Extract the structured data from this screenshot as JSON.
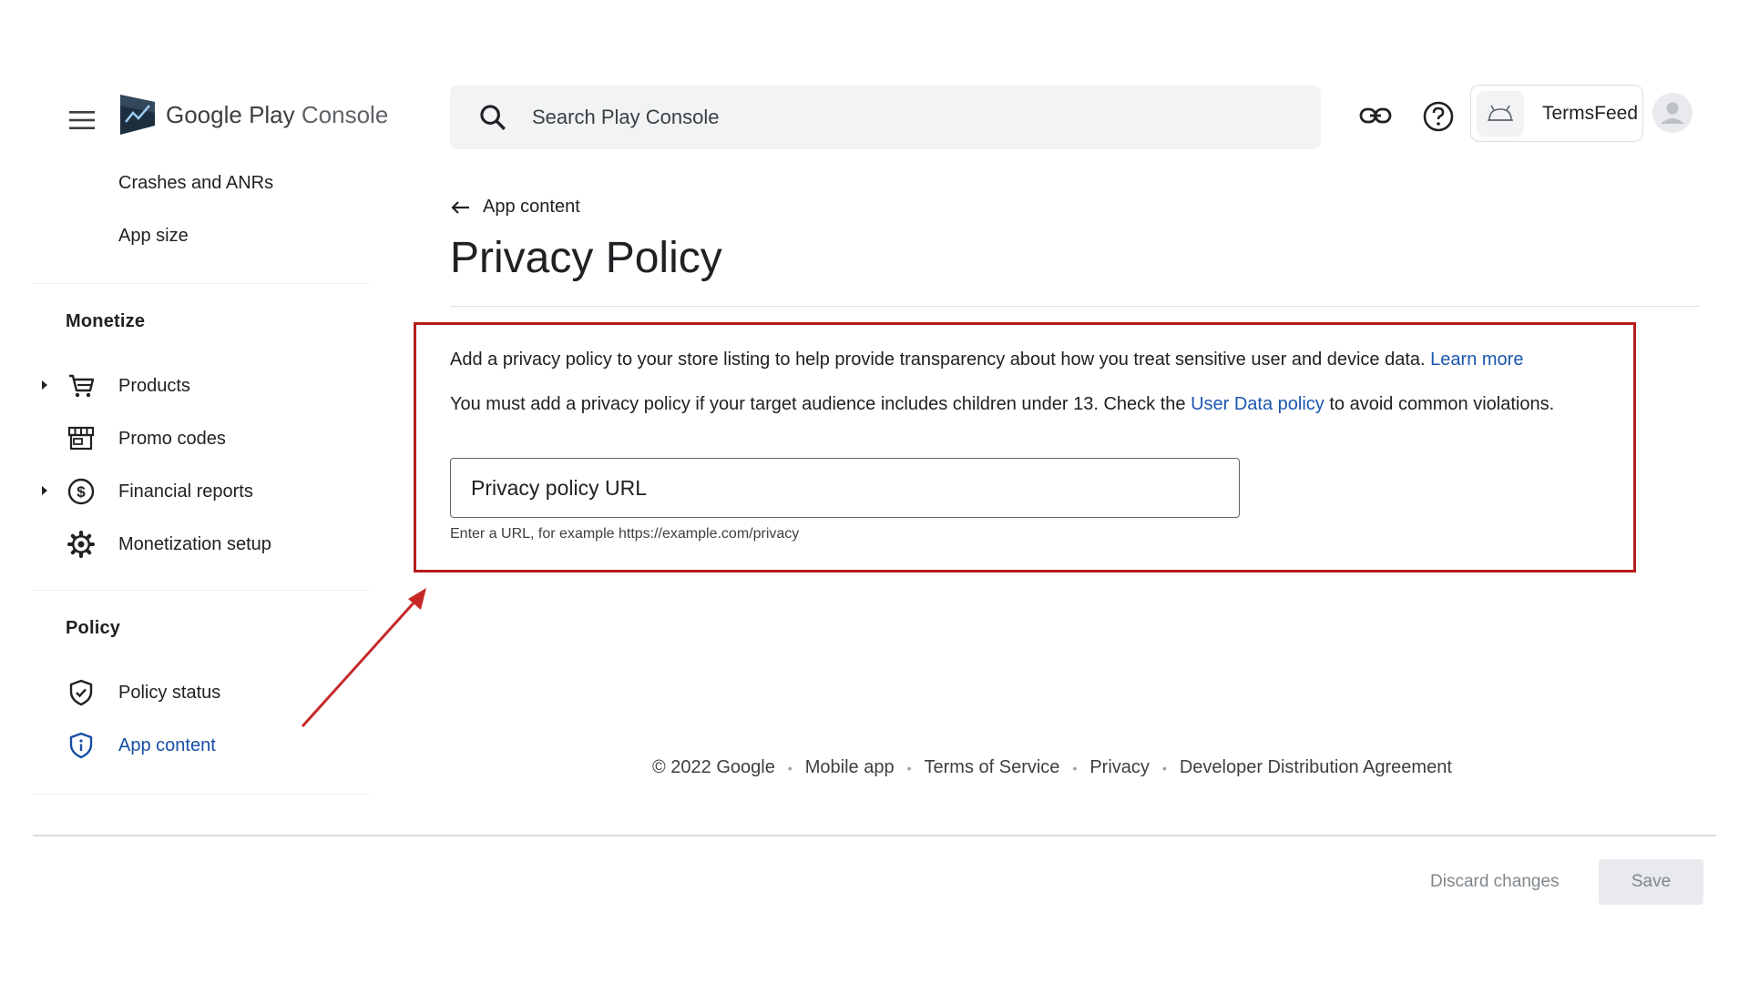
{
  "header": {
    "brand_google_play": "Google Play",
    "brand_console": "Console",
    "search_placeholder": "Search Play Console",
    "account_name": "TermsFeed"
  },
  "sidebar": {
    "top_items": [
      {
        "label": "Crashes and ANRs"
      },
      {
        "label": "App size"
      }
    ],
    "sections": [
      {
        "title": "Monetize",
        "items": [
          {
            "label": "Products",
            "icon": "shopping-cart-icon",
            "expandable": true
          },
          {
            "label": "Promo codes",
            "icon": "store-icon",
            "expandable": false
          },
          {
            "label": "Financial reports",
            "icon": "dollar-circle-icon",
            "expandable": true
          },
          {
            "label": "Monetization setup",
            "icon": "gear-icon",
            "expandable": false
          }
        ]
      },
      {
        "title": "Policy",
        "items": [
          {
            "label": "Policy status",
            "icon": "shield-check-icon",
            "active": false
          },
          {
            "label": "App content",
            "icon": "shield-info-icon",
            "active": true
          }
        ]
      }
    ]
  },
  "main": {
    "back_label": "App content",
    "title": "Privacy Policy",
    "para1_text": "Add a privacy policy to your store listing to help provide transparency about how you treat sensitive user and device data.",
    "para1_link": "Learn more",
    "para2_before": "You must add a privacy policy if your target audience includes children under 13. Check the",
    "para2_link": "User Data policy",
    "para2_after": "to avoid common violations.",
    "input_placeholder": "Privacy policy URL",
    "input_value": "",
    "helper_text": "Enter a URL, for example https://example.com/privacy"
  },
  "footer": {
    "copyright": "© 2022 Google",
    "links": [
      "Mobile app",
      "Terms of Service",
      "Privacy",
      "Developer Distribution Agreement"
    ]
  },
  "actions": {
    "discard_label": "Discard changes",
    "save_label": "Save"
  },
  "colors": {
    "highlight_border": "#b71c1c",
    "link": "#1a56b0",
    "active_nav": "#174ea6",
    "annotation_arrow": "#c62828"
  }
}
